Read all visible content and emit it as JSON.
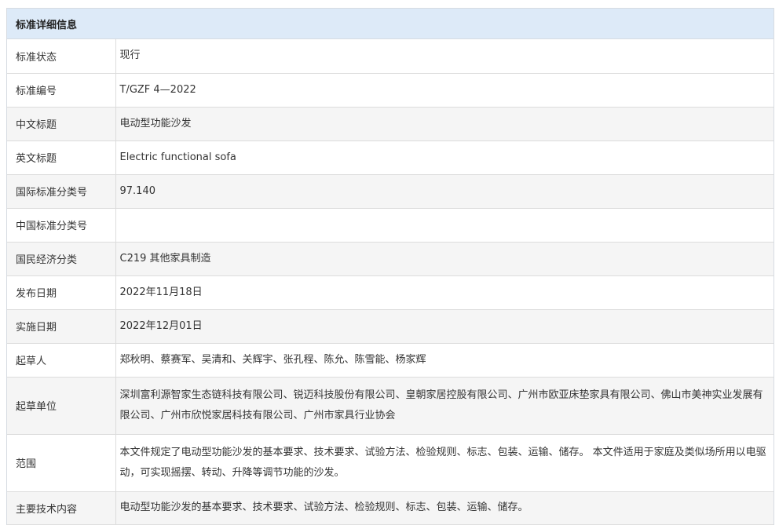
{
  "header": {
    "title": "标准详细信息"
  },
  "rows": [
    {
      "label": "标准状态",
      "value": "现行"
    },
    {
      "label": "标准编号",
      "value": "T/GZF 4—2022"
    },
    {
      "label": "中文标题",
      "value": "电动型功能沙发"
    },
    {
      "label": "英文标题",
      "value": "Electric functional sofa"
    },
    {
      "label": "国际标准分类号",
      "value": "97.140"
    },
    {
      "label": "中国标准分类号",
      "value": ""
    },
    {
      "label": "国民经济分类",
      "value": "C219 其他家具制造"
    },
    {
      "label": "发布日期",
      "value": "2022年11月18日"
    },
    {
      "label": "实施日期",
      "value": "2022年12月01日"
    },
    {
      "label": "起草人",
      "value": "郑秋明、蔡赛军、吴清和、关辉宇、张孔程、陈允、陈雪能、杨家辉"
    },
    {
      "label": "起草单位",
      "value": "深圳富利源智家生态链科技有限公司、锐迈科技股份有限公司、皇朝家居控股有限公司、广州市欧亚床垫家具有限公司、佛山市美神实业发展有限公司、广州市欣悦家居科技有限公司、广州市家具行业协会"
    },
    {
      "label": "范围",
      "value": "本文件规定了电动型功能沙发的基本要求、技术要求、试验方法、检验规则、标志、包装、运输、储存。 本文件适用于家庭及类似场所用以电驱动，可实现摇摆、转动、升降等调节功能的沙发。"
    },
    {
      "label": "主要技术内容",
      "value": "电动型功能沙发的基本要求、技术要求、试验方法、检验规则、标志、包装、运输、储存。"
    }
  ]
}
